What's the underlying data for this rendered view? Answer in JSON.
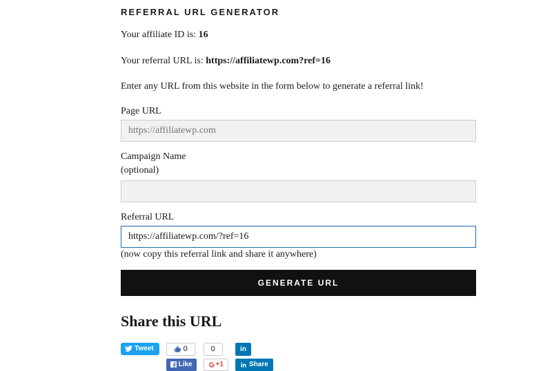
{
  "heading": "REFERRAL URL GENERATOR",
  "affiliate_id_label": "Your affiliate ID is: ",
  "affiliate_id_value": "16",
  "referral_url_label": "Your referral URL is: ",
  "referral_url_value": "https://affiliatewp.com?ref=16",
  "instruction": "Enter any URL from this website in the form below to generate a referral link!",
  "page_url": {
    "label": "Page URL",
    "placeholder": "https://affiliatewp.com"
  },
  "campaign": {
    "label": "Campaign Name",
    "sublabel": "(optional)",
    "value": ""
  },
  "referral": {
    "label": "Referral URL",
    "value": "https://affiliatewp.com/?ref=16",
    "hint": "(now copy this referral link and share it anywhere)"
  },
  "generate_button": "GENERATE URL",
  "share_heading": "Share this URL",
  "social": {
    "tweet_label": "Tweet",
    "thumb_count": "0",
    "fb_like_label": "Like",
    "gplus_count": "0",
    "gplus_label": "+1",
    "linkedin_label": "in",
    "linkedin_share_label": "Share"
  }
}
